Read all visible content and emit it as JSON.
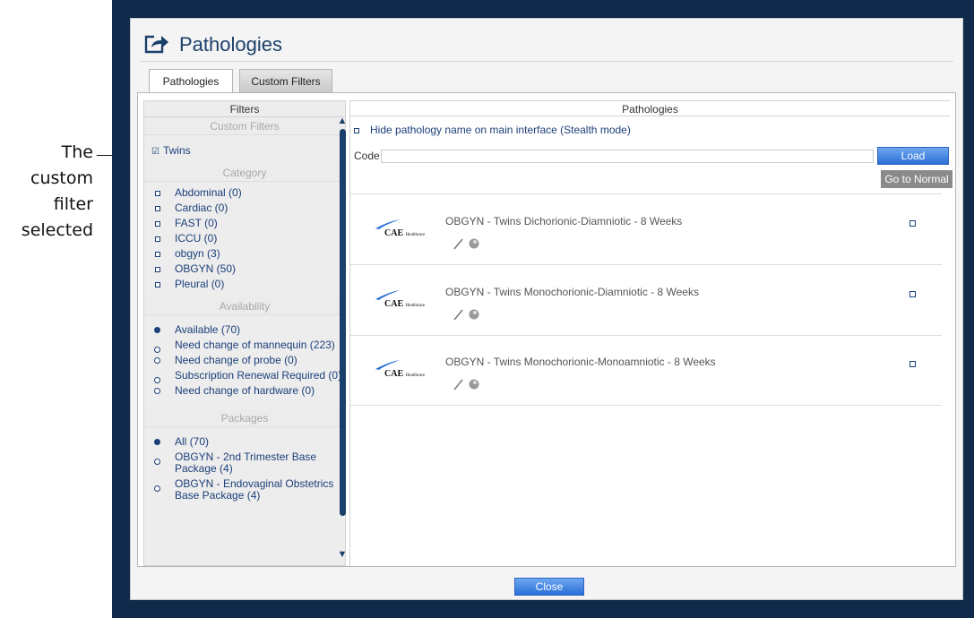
{
  "annotation": {
    "lines": [
      "The",
      "custom",
      "filter",
      "selected"
    ]
  },
  "window": {
    "title": "Pathologies"
  },
  "tabs": [
    {
      "label": "Pathologies",
      "active": true
    },
    {
      "label": "Custom Filters",
      "active": false
    }
  ],
  "filters": {
    "header": "Filters",
    "custom_filters": {
      "heading": "Custom Filters",
      "items": [
        {
          "label": "Twins",
          "checked": true
        }
      ]
    },
    "category": {
      "heading": "Category",
      "items": [
        {
          "label": "Abdominal (0)"
        },
        {
          "label": "Cardiac (0)"
        },
        {
          "label": "FAST (0)"
        },
        {
          "label": "ICCU (0)"
        },
        {
          "label": "obgyn (3)"
        },
        {
          "label": "OBGYN (50)"
        },
        {
          "label": "Pleural (0)"
        }
      ]
    },
    "availability": {
      "heading": "Availability",
      "items": [
        {
          "label": "Available (70)",
          "selected": true
        },
        {
          "label": "Need change of mannequin (223)",
          "selected": false
        },
        {
          "label": "Need change of probe (0)",
          "selected": false
        },
        {
          "label": "Subscription Renewal Required (0)",
          "selected": false
        },
        {
          "label": "Need change of hardware (0)",
          "selected": false
        }
      ]
    },
    "packages": {
      "heading": "Packages",
      "items": [
        {
          "label": "All (70)",
          "selected": true
        },
        {
          "label": "OBGYN - 2nd Trimester Base Package (4)",
          "selected": false
        },
        {
          "label": "OBGYN - Endovaginal Obstetrics Base Package (4)",
          "selected": false
        }
      ]
    }
  },
  "pathologies": {
    "header": "Pathologies",
    "stealth_label": "Hide pathology name on main interface (Stealth mode)",
    "code_label": "Code",
    "code_value": "",
    "load_label": "Load",
    "normal_label": "Go to Normal",
    "items": [
      {
        "name": "OBGYN - Twins Dichorionic-Diamniotic - 8 Weeks",
        "logo": "CAE",
        "logo_small": "Healthcare"
      },
      {
        "name": "OBGYN - Twins Monochorionic-Diamniotic - 8 Weeks",
        "logo": "CAE",
        "logo_small": "Healthcare"
      },
      {
        "name": "OBGYN - Twins Monochorionic-Monoamniotic - 8 Weeks",
        "logo": "CAE",
        "logo_small": "Healthcare"
      }
    ]
  },
  "footer": {
    "close_label": "Close"
  },
  "colors": {
    "frame": "#0f2a4a",
    "accent": "#2a6fd6",
    "link": "#1b3f7a"
  }
}
